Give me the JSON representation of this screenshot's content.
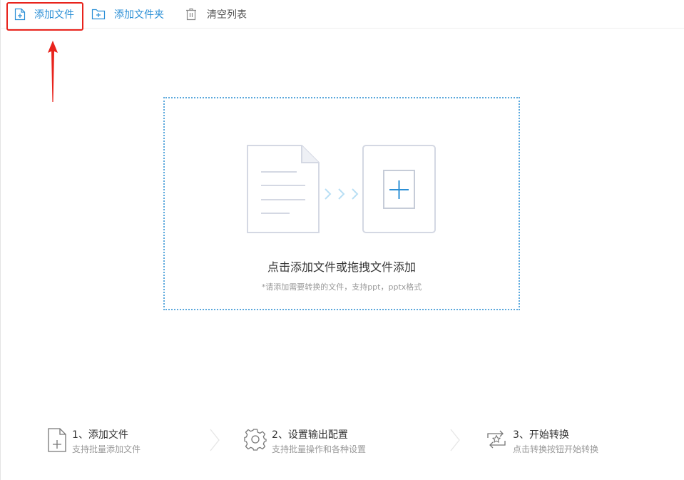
{
  "toolbar": {
    "add_file": "添加文件",
    "add_folder": "添加文件夹",
    "clear_list": "清空列表"
  },
  "dropzone": {
    "title": "点击添加文件或拖拽文件添加",
    "hint": "*请添加需要转换的文件，支持ppt，pptx格式"
  },
  "steps": [
    {
      "title": "1、添加文件",
      "desc": "支持批量添加文件",
      "icon": "file-plus-icon"
    },
    {
      "title": "2、设置输出配置",
      "desc": "支持批量操作和各种设置",
      "icon": "gear-icon"
    },
    {
      "title": "3、开始转换",
      "desc": "点击转换按钮开始转换",
      "icon": "convert-icon"
    }
  ],
  "colors": {
    "accent": "#2b8fd6",
    "highlight": "#e8231c",
    "dropzone_border": "#5ba8dc",
    "illustration": "#d4d8e3"
  }
}
